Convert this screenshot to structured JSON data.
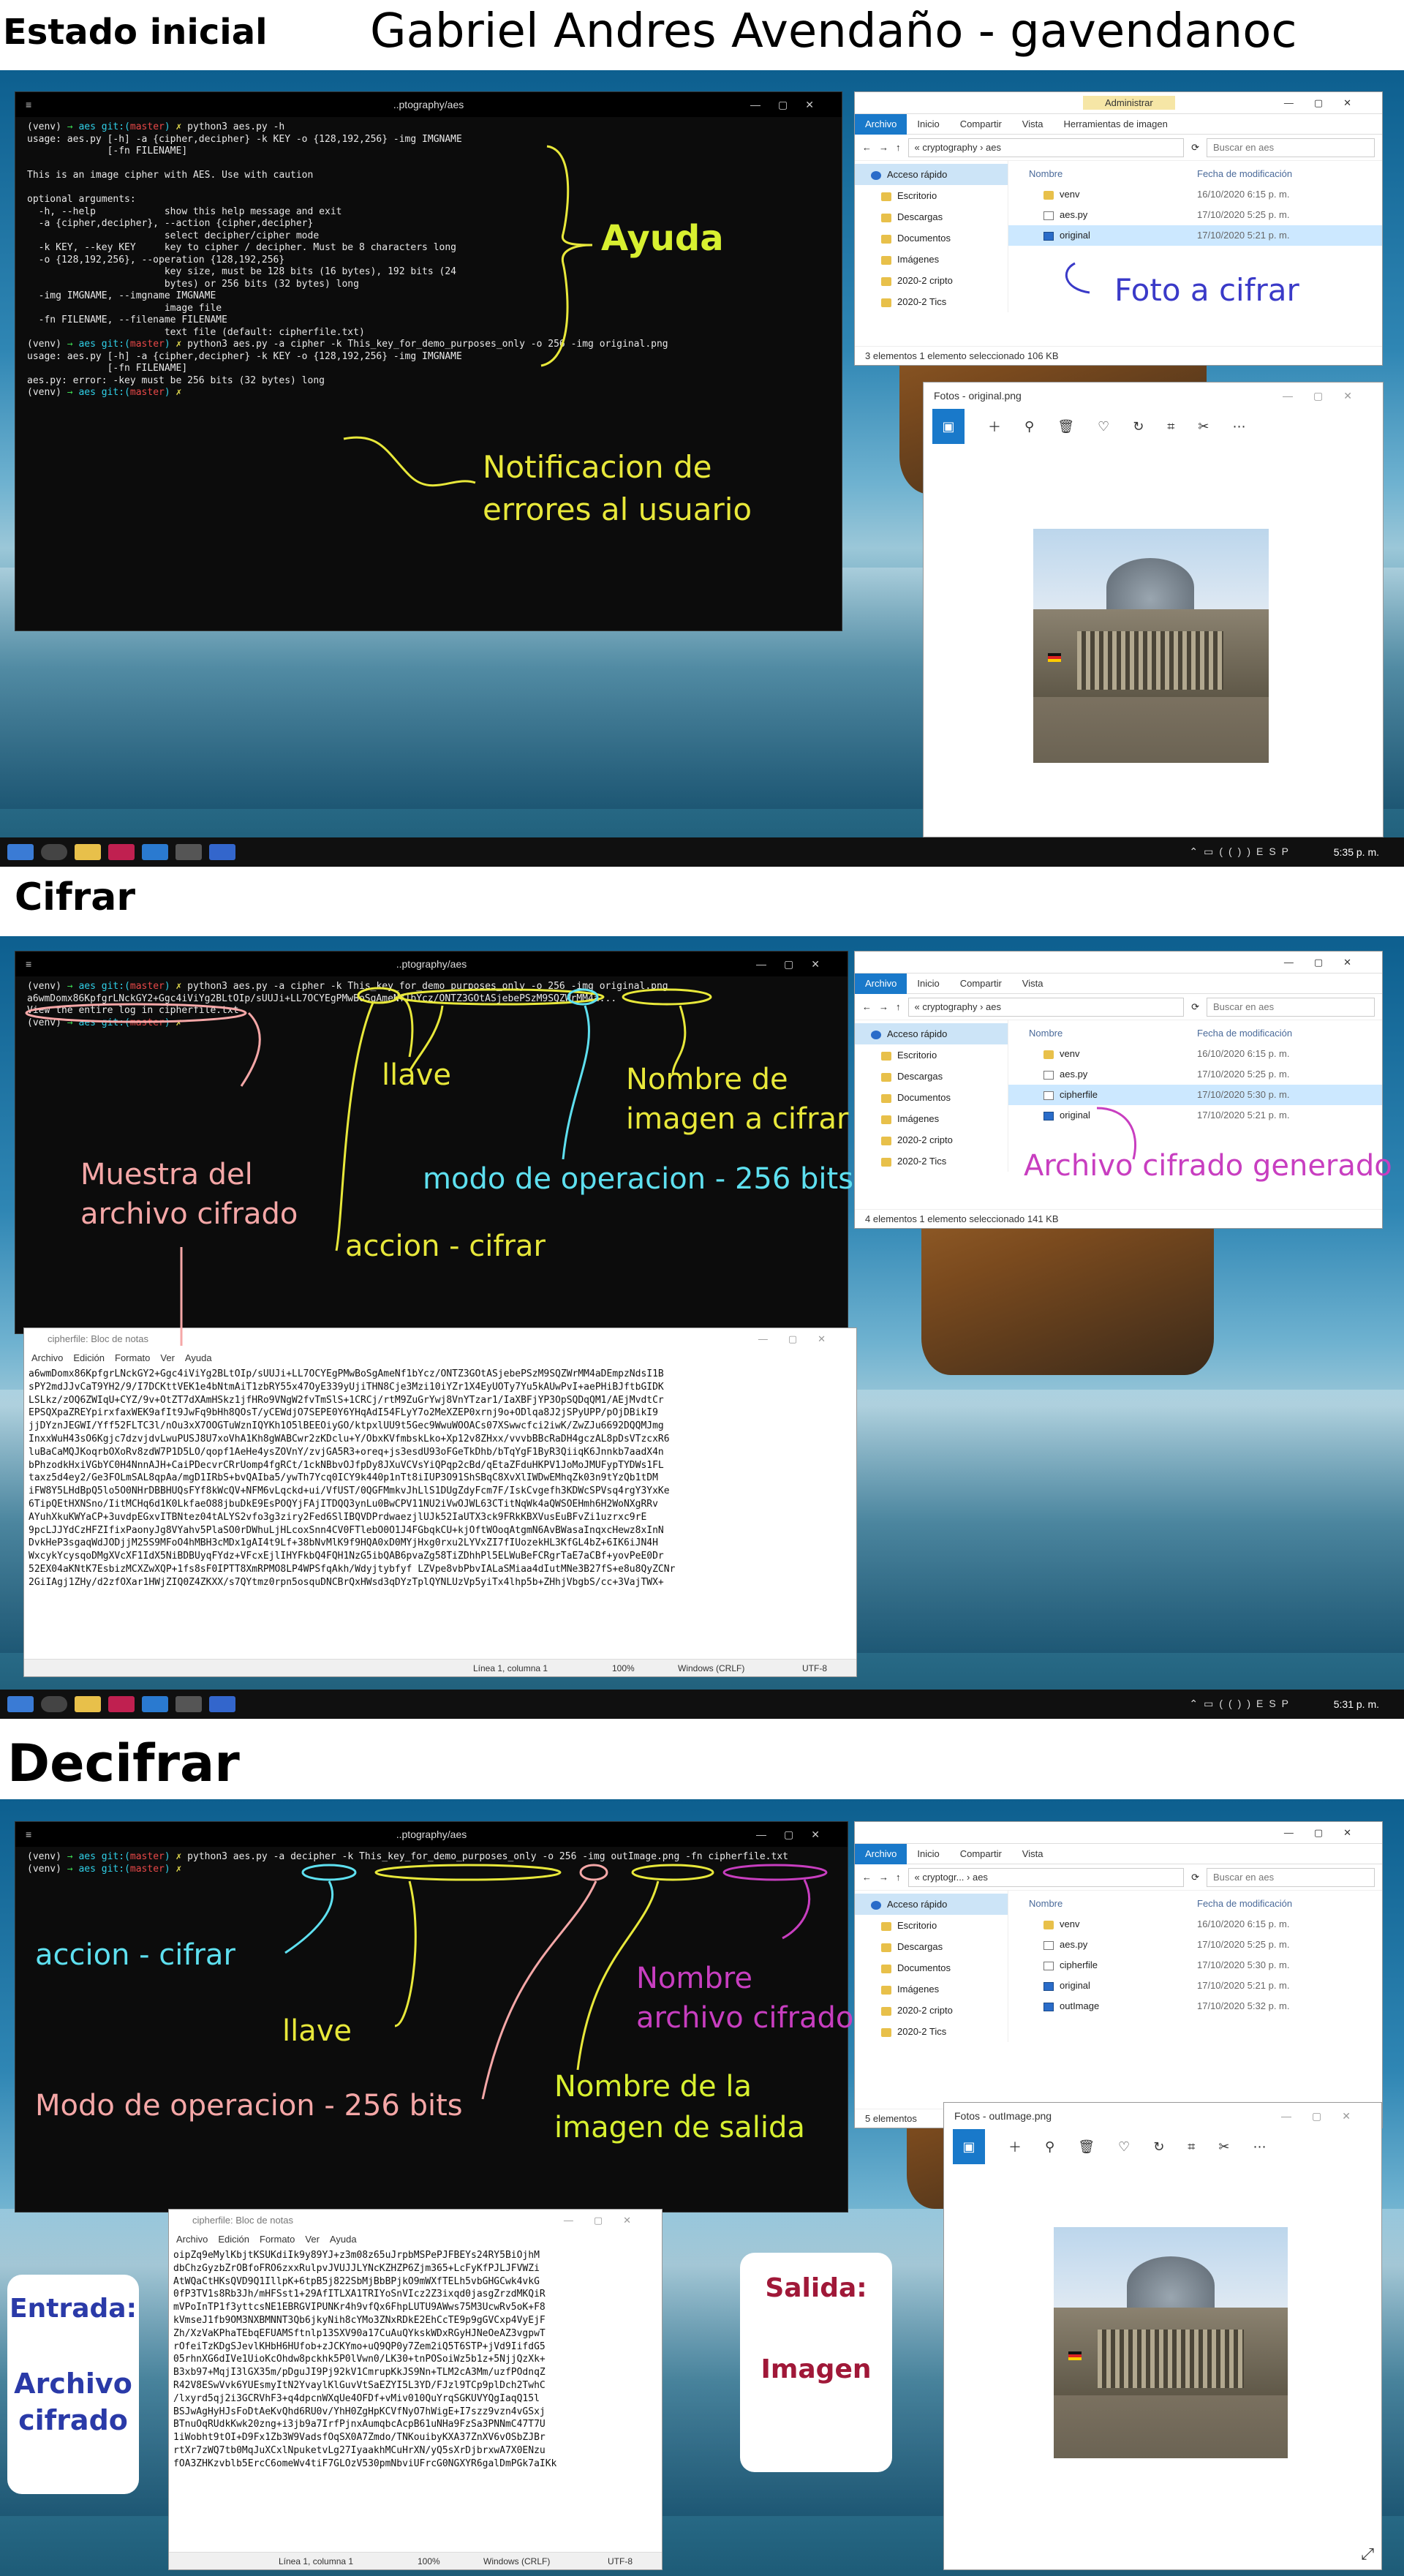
{
  "section1": {
    "heading": "Estado inicial",
    "author": "Gabriel Andres Avendaño - gavendanoc",
    "terminal": {
      "title": "..ptography/aes",
      "lines": [
        "(venv) → aes git:(master) ✗ python3 aes.py -h",
        "usage: aes.py [-h] -a {cipher,decipher} -k KEY -o {128,192,256} -img IMGNAME",
        "              [-fn FILENAME]",
        "",
        "This is an image cipher with AES. Use with caution",
        "",
        "optional arguments:",
        "  -h, --help            show this help message and exit",
        "  -a {cipher,decipher}, --action {cipher,decipher}",
        "                        select decipher/cipher mode",
        "  -k KEY, --key KEY     key to cipher / decipher. Must be 8 characters long",
        "  -o {128,192,256}, --operation {128,192,256}",
        "                        key size, must be 128 bits (16 bytes), 192 bits (24",
        "                        bytes) or 256 bits (32 bytes) long",
        "  -img IMGNAME, --imgname IMGNAME",
        "                        image file",
        "  -fn FILENAME, --filename FILENAME",
        "                        text file (default: cipherfile.txt)",
        "(venv) → aes git:(master) ✗ python3 aes.py -a cipher -k This_key_for_demo_purposes_only -o 256 -img original.png",
        "usage: aes.py [-h] -a {cipher,decipher} -k KEY -o {128,192,256} -img IMGNAME",
        "              [-fn FILENAME]",
        "aes.py: error: -key must be 256 bits (32 bytes) long",
        "(venv) → aes git:(master) ✗"
      ]
    },
    "explorer": {
      "title_tab": "Administrar",
      "ribbon": [
        "Archivo",
        "Inicio",
        "Compartir",
        "Vista",
        "Herramientas de imagen"
      ],
      "path": "« cryptography › aes",
      "search": "Buscar en aes",
      "nav": [
        "Acceso rápido",
        "Escritorio",
        "Descargas",
        "Documentos",
        "Imágenes",
        "2020-2 cripto",
        "2020-2 Tics"
      ],
      "col_name": "Nombre",
      "col_date": "Fecha de modificación",
      "files": [
        {
          "name": "venv",
          "date": "16/10/2020 6:15 p. m.",
          "icon": "folder",
          "sel": false
        },
        {
          "name": "aes.py",
          "date": "17/10/2020 5:25 p. m.",
          "icon": "doc",
          "sel": false
        },
        {
          "name": "original",
          "date": "17/10/2020 5:21 p. m.",
          "icon": "img",
          "sel": true
        }
      ],
      "status": "3 elementos     1 elemento seleccionado  106 KB"
    },
    "photos_title": "Fotos - original.png",
    "ann_help": "Ayuda",
    "ann_photo": "Foto a cifrar",
    "ann_notif_1": "Notificacion de",
    "ann_notif_2": "errores al usuario",
    "clock": "5:35 p. m."
  },
  "section2": {
    "heading": "Cifrar",
    "terminal": {
      "title": "..ptography/aes",
      "lines": [
        "(venv) → aes git:(master) ✗ python3 aes.py -a cipher -k This_key_for_demo_purposes_only -o 256 -img original.png",
        "a6wmDomx86KpfgrLNckGY2+Ggc4iViYg2BLtOIp/sUUJi+LL7OCYEgPMwBoSgAmeNf1bYcz/ONTZ3GOtASjebePSzM9SQZWrMM4a...",
        "View the entire log in cipherfile.txt",
        "(venv) → aes git:(master) ✗"
      ]
    },
    "explorer": {
      "ribbon": [
        "Archivo",
        "Inicio",
        "Compartir",
        "Vista"
      ],
      "path": "« cryptography › aes",
      "search": "Buscar en aes",
      "nav": [
        "Acceso rápido",
        "Escritorio",
        "Descargas",
        "Documentos",
        "Imágenes",
        "2020-2 cripto",
        "2020-2 Tics"
      ],
      "col_name": "Nombre",
      "col_date": "Fecha de modificación",
      "files": [
        {
          "name": "venv",
          "date": "16/10/2020 6:15 p. m.",
          "icon": "folder",
          "sel": false
        },
        {
          "name": "aes.py",
          "date": "17/10/2020 5:25 p. m.",
          "icon": "doc",
          "sel": false
        },
        {
          "name": "cipherfile",
          "date": "17/10/2020 5:30 p. m.",
          "icon": "doc",
          "sel": true
        },
        {
          "name": "original",
          "date": "17/10/2020 5:21 p. m.",
          "icon": "img",
          "sel": false
        }
      ],
      "status": "4 elementos     1 elemento seleccionado  141 KB"
    },
    "notepad": {
      "title": "cipherfile: Bloc de notas",
      "menu": [
        "Archivo",
        "Edición",
        "Formato",
        "Ver",
        "Ayuda"
      ],
      "lines": [
        "a6wmDomx86KpfgrLNckGY2+Ggc4iViYg2BLtOIp/sUUJi+LL7OCYEgPMwBoSgAmeNf1bYcz/ONTZ3GOtASjebePSzM9SQZWrMM4aDEmpzNdsI1B",
        "sPY2mdJJvCaT9YH2/9/I7DCKttVEK1e4bNtmAiT1zbRY55x47OyE339yUjiTHN8Cje3Mzi10iYZr1X4EyUOTy7Yu5kAUwPvI+aePHiBJftbGIDK",
        "LSLkz/zOQ6ZWIqU+CYZ/9v+OtZT7dXAmHSkz1jfHRo9VNgW2fvTmSlS+1CRCj/rtM9ZuGrYwj8VnYTzar1/IaXBFjYP3OpSQDqQM1/AEjMvdtCr",
        "EPSQXpaZREYpirxfaxWEK9afIt9JwFq9bHh8QOsT/yCEWdjO7SEPE0Y6YHqAdI54FLyY7o2MeXZEP0xrnj9o+ODlqa8J2jSPyUPP/pOjDBikI9",
        "jjDYznJEGWI/Yff52FLTC3l/nOu3xX7OOGTuWznIQYKh1O5lBEEOiyGO/ktpxlUU9t5Gec9WwuWOOACs07XSwwcfci2iwK/ZwZJu6692DQQMJmg",
        "InxxWuH43sO6Kgjc7dzvjdvLwuPUSJ8U7xoVhA1Kh8gWABCwr2zKDclu+Y/ObxKVfmbskLko+Xp12v8ZHxx/vvvbBBcRaDH4gczAL8pDsVTzcxR6",
        "luBaCaMQJKoqrbOXoRv8zdW7P1D5LO/qopf1AeHe4ysZOVnY/zvjGA5R3+oreq+js3esdU93oFGeTkDhb/bTqYgF1ByR3QiiqK6Jnnkb7aadX4n",
        "bPhzodkHxiVGbYC0H4NnnAJH+CaiPDecvrCRrUomp4fgRCt/1ckNBbvOJfpDy8JXuVCVsYiQPqp2cBd/qEtaZFduHKPV1JoMoJMUFypTYDWs1FL",
        "taxz5d4ey2/Ge3FOLmSAL8qpAa/mgD1IRbS+bvQAIba5/ywTh7Ycq0ICY9k440p1nTt8iIUP3O91ShSBqC8XvXlIWDwEMhqZk03n9tYzQb1tDM",
        "iFW8Y5LHdBpQ5lo5O0NHrDBBHUQsFYf8kWcQV+NFM6vLqckd+ui/VfUST/0QGFMmkvJhLlS1DUgZdyFcm7F/IskCvgefh3KDWcSPVsq4rgY3YxKe",
        "6TipQEtHXNSno/IitMCHq6d1K0LkfaeO88jbuDkE9EsPOQYjFAjITDQQ3ynLu0BwCPV11NU2iVwOJWL63CTitNqWk4aQWSOEHmh6H2WoNXgRRv",
        "AYuhXkuKWYaCP+3uvdpEGxvITBNtez04tALYS2vfo3g3ziry2Fed6SlIBQVDPrdwaezjlUJk52IaUTX3ck9FRkKBXVusEuBFvZi1uzrxc9rE",
        "9pcLJJYdCzHFZIfixPaonyJg8VYahv5PlaSO0rDWhuLjHLcoxSnn4CV0FTlebO0O1J4FGbqkCU+kjOftWOoqAtgmN6AvBWasaInqxcHewz8xInN",
        "DvkHeP3sgaqWdJODjjM25S9MFoO4hMBH3cMDx1gAI4t9Lf+38bNvMlK9f9HQA0xD0MYjHxg0rxu2LYVxZI7fIUozekHL3KfGL4bZ+6IK6iJN4H",
        "WxcykYcysqoDMgXVcXF1IdX5NiBDBUyqFYdz+VFcxEjlIHYFkbQ4FQH1NzG5ibQAB6pvaZg58TiZDhhPl5ELWuBeFCRgrTaE7aCBf+yovPeE0Dr",
        "52EX04aKNtK7EsbizMCXZwXQP+1fs8sF0IPTT8XmRPMO8LP4WPSfqAkh/Wdyjtybfyf LZVpe8vbPbvIALaSMiaa4dIutMNe3B27fS+e8u8QyZCNr",
        "2GiIAgj1ZHy/d2zfOXar1HWjZIQ0Z4ZKXX/s7QYtmz0rpn5osquDNCBrQxHWsd3qDYzTplQYNLUzVp5yiTx4lhp5b+ZHhjVbgbS/cc+3VajTWX+"
      ],
      "status": [
        "Línea 1, columna 1",
        "100%",
        "Windows (CRLF)",
        "UTF-8"
      ]
    },
    "ann_key": "llave",
    "ann_img_1": "Nombre de",
    "ann_img_2": "imagen a cifrar",
    "ann_sample_1": "Muestra del",
    "ann_sample_2": "archivo cifrado",
    "ann_mode": "modo de operacion - 256 bits",
    "ann_action": "accion - cifrar",
    "ann_generated": "Archivo cifrado generado",
    "clock": "5:31 p. m."
  },
  "section3": {
    "heading": "Decifrar",
    "terminal": {
      "title": "..ptography/aes",
      "lines": [
        "(venv) → aes git:(master) ✗ python3 aes.py -a decipher -k This_key_for_demo_purposes_only -o 256 -img outImage.png -fn cipherfile.txt",
        "(venv) → aes git:(master) ✗"
      ]
    },
    "explorer": {
      "ribbon": [
        "Archivo",
        "Inicio",
        "Compartir",
        "Vista"
      ],
      "path": "« cryptogr... › aes",
      "search": "Buscar en aes",
      "nav": [
        "Acceso rápido",
        "Escritorio",
        "Descargas",
        "Documentos",
        "Imágenes",
        "2020-2 cripto",
        "2020-2 Tics"
      ],
      "col_name": "Nombre",
      "col_date": "Fecha de modificación",
      "files": [
        {
          "name": "venv",
          "date": "16/10/2020 6:15 p. m.",
          "icon": "folder",
          "sel": false
        },
        {
          "name": "aes.py",
          "date": "17/10/2020 5:25 p. m.",
          "icon": "doc",
          "sel": false
        },
        {
          "name": "cipherfile",
          "date": "17/10/2020 5:30 p. m.",
          "icon": "doc",
          "sel": false
        },
        {
          "name": "original",
          "date": "17/10/2020 5:21 p. m.",
          "icon": "img",
          "sel": false
        },
        {
          "name": "outImage",
          "date": "17/10/2020 5:32 p. m.",
          "icon": "img",
          "sel": false
        }
      ],
      "status": "5 elementos"
    },
    "photos_title": "Fotos - outImage.png",
    "notepad": {
      "title": "cipherfile: Bloc de notas",
      "menu": [
        "Archivo",
        "Edición",
        "Formato",
        "Ver",
        "Ayuda"
      ],
      "lines": [
        "oipZq9eMylKbjtKSUKdiIk9y89YJ+z3m08z65uJrpbMSPePJFBEYs24RY5BiOjhM",
        "dbChzGyzbZrOBfoFRO6zxxRulpvJVUJJLYNcKZHZP6Zjm365+LcFyKfPJLJFVWZi",
        "AtWQaCtHKsQVD9Q1IllpK+6tpB5j822SbMjBbBPjkO9mWXfTELh5vbGHGCwk4vkG",
        "0fP3TV1s8Rb3Jh/mHFSst1+29AfITLXA1TRIYoSnVIcz2Z3ixqd0jasgZrzdMKQiR",
        "mVPoInTP1f3yttcsNE1EBRGVIPUNKr4h9vfQx6FhpLUTU9AWws75M3UcwRv5oK+F8",
        "kVmseJ1fb9OM3NXBMNNT3Qb6jkyNih8cYMo3ZNxRDkE2EhCcTE9p9gGVCxp4VyEjF",
        "Zh/XzVaKPhaTEbqEFUAMSftnlp13SXV90a17CuAuQYkskWDxRGyHJNeOeAZ3vgpwT",
        "rOfeiTzKDgSJevlKHbH6HUfob+zJCKYmo+uQ9QP0y7Zem2iQ5T6STP+jVd9IifdG5",
        "05rhnXG6dIVe1UioKcOhdw8pckhk5P0lVwn0/LK30+tnPOSoiWz5b1z+5NjjQzXk+",
        "B3xb97+MqjI3lGX35m/pDguJI9Pj92kV1CmrupKkJS9Nn+TLM2cA3Mm/uzfPOdnqZ",
        "R42V8ESwVvk6YUEsmyItN2YvaylKlGuvVtSaEZYI5L3YD/FJzl9TCp9plDch2TwhC",
        "/lxyrd5qj2i3GCRVhF3+q4dpcnWXqUe4OFDf+vMiv010QuYrqSGKUVYQgIaqQ15l",
        "BSJwAgHyHJsFoDtAeKvQhd6RU0v/YhH0ZgHpKCVfNyO7hWigE+I7szz9vzn4vGSxj",
        "BTnuOqRUdkKwk20zng+i3jb9a7IrfPjnxAumqbcAcpB61uNHa9FzSa3PNNmC47T7U",
        "1iWobht9tOI+D9Fx1Zb3W9VadsfOqSX0A7Zmdo/TNKouibyKXA37ZnXV6vOSbZJBr",
        "rtXr7zWQ7tb0MqJuXCxlNpuketvLg27IyaakhMCuHrXN/yQ5sXrDjbrxwA7X0ENzu",
        "fOA3ZHKzvblb5ErcC6omeWv4tiF7GLOzV530pmNbviUFrcG0NGXYR6galDmPGk7aIKk"
      ],
      "status": [
        "Línea 1, columna 1",
        "100%",
        "Windows (CRLF)",
        "UTF-8"
      ]
    },
    "ann_action": "accion - cifrar",
    "ann_key": "llave",
    "ann_mode": "Modo de operacion - 256 bits",
    "ann_cname_1": "Nombre",
    "ann_cname_2": "archivo cifrado",
    "ann_out_1": "Nombre de la",
    "ann_out_2": "imagen de salida",
    "card_in_title": "Entrada:",
    "card_in_body_1": "Archivo",
    "card_in_body_2": "cifrado",
    "card_out_title": "Salida:",
    "card_out_body": "Imagen"
  },
  "colors": {
    "yellow": "#e8e83a",
    "cyan": "#5ee0f0",
    "pink": "#f5a7a7",
    "magenta": "#c83ec0",
    "blue": "#3a3ac8",
    "green_yellow": "#d8f030"
  }
}
